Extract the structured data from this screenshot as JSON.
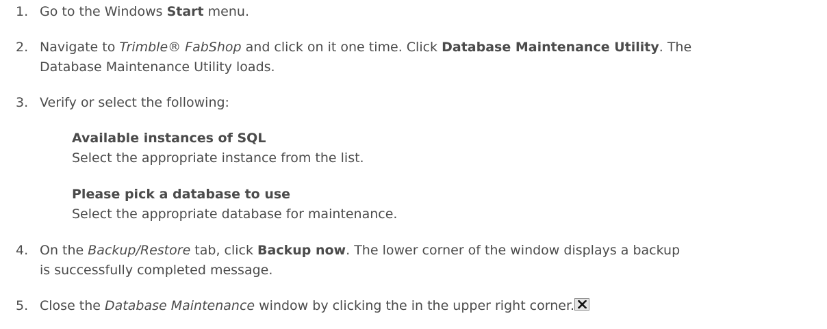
{
  "steps": [
    {
      "number": "1.",
      "parts": [
        "Go to the Windows ",
        "Start",
        " menu."
      ]
    },
    {
      "number": "2.",
      "parts": [
        "Navigate to ",
        "Trimble® FabShop",
        " and click on it one time. Click ",
        "Database Maintenance Utility",
        ". The"
      ],
      "line2": "Database Maintenance Utility loads."
    },
    {
      "number": "3.",
      "intro": "Verify or select the following:",
      "definitions": [
        {
          "term": "Available instances of SQL",
          "desc": "Select the appropriate instance from the list."
        },
        {
          "term": "Please pick a database to use",
          "desc": "Select the appropriate database for maintenance."
        }
      ]
    },
    {
      "number": "4.",
      "parts": [
        "On the ",
        "Backup/Restore",
        " tab, click ",
        "Backup now",
        ". The lower corner of the window displays a backup"
      ],
      "line2": "is successfully completed message."
    },
    {
      "number": "5.",
      "parts": [
        "Close the ",
        "Database Maintenance",
        " window by clicking the",
        " in the upper right corner."
      ],
      "icon": "close-x-icon"
    }
  ]
}
